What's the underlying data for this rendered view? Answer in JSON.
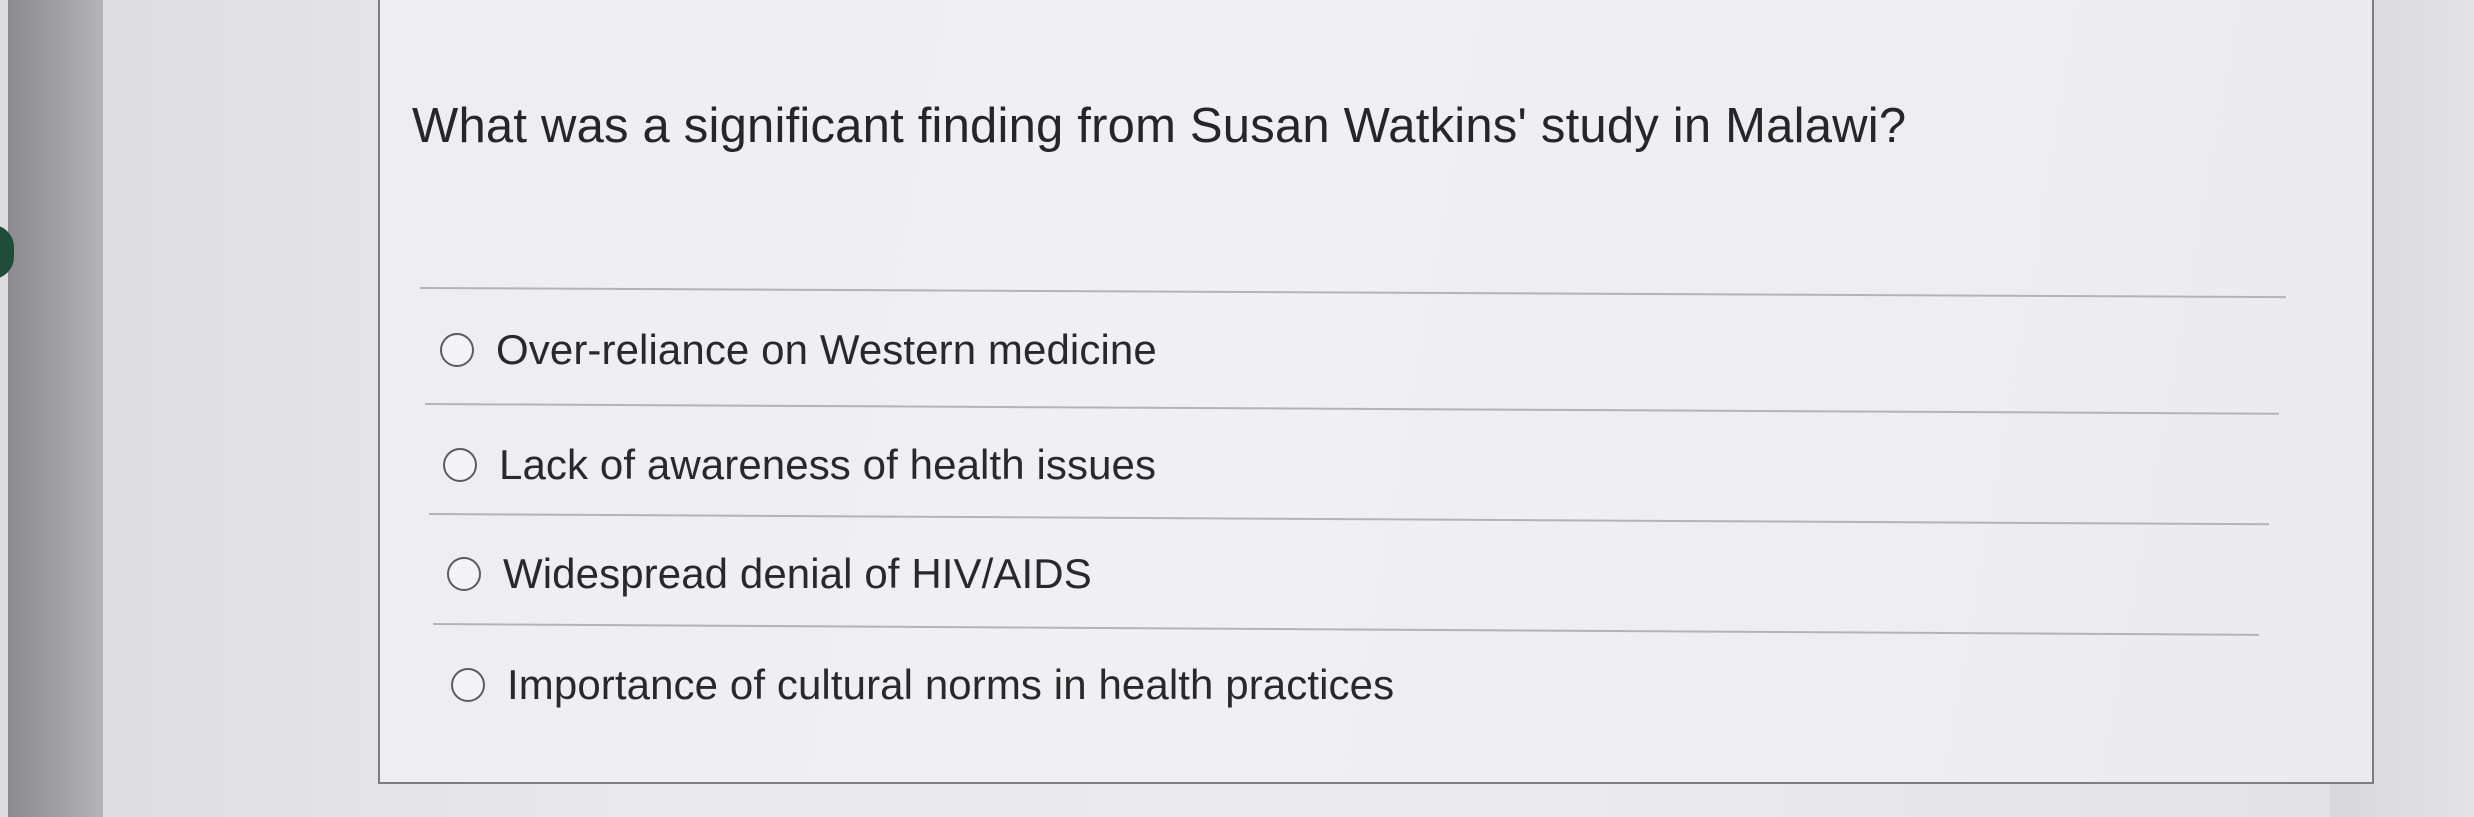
{
  "question": {
    "text": "What was a significant finding from Susan Watkins' study in Malawi?"
  },
  "options": [
    {
      "label": "Over-reliance on Western medicine",
      "selected": false
    },
    {
      "label": "Lack of awareness of health issues",
      "selected": false
    },
    {
      "label": "Widespread denial of HIV/AIDS",
      "selected": false
    },
    {
      "label": "Importance of cultural norms in health practices",
      "selected": false
    }
  ],
  "colors": {
    "background": "#e6e6e8",
    "card": "#efeff1",
    "text": "#262628",
    "divider": "#b4b4b8",
    "radio_border": "#5c5c60",
    "side_tab": "#1f4d3a"
  }
}
